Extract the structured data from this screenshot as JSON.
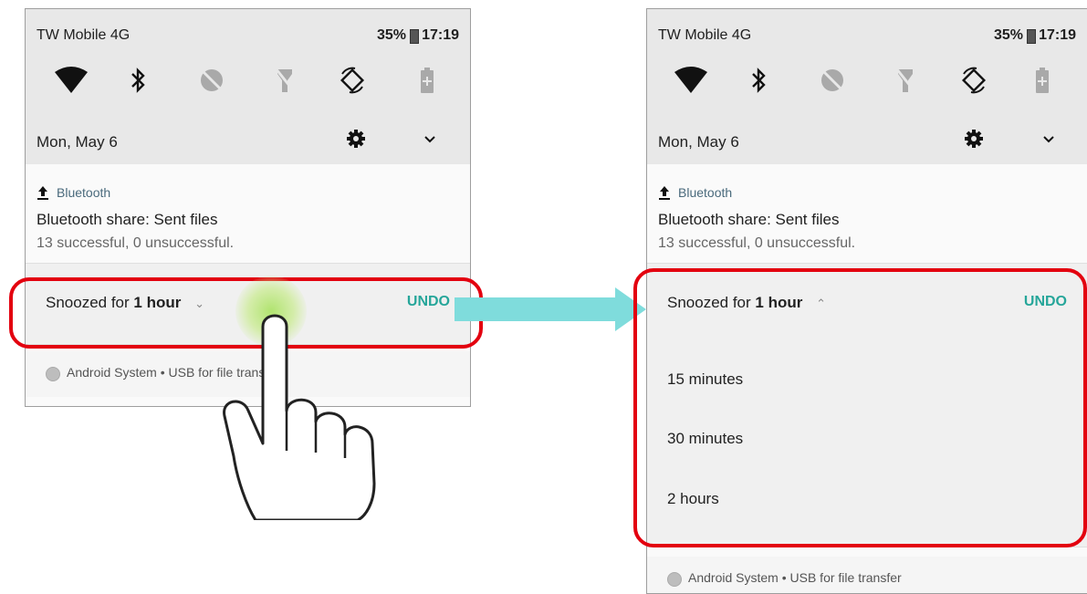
{
  "left_screen": {
    "status": {
      "carrier": "TW Mobile 4G",
      "battery": "35%",
      "time": "17:19"
    },
    "date": "Mon, May 6",
    "notification": {
      "app": "Bluetooth",
      "title": "Bluetooth share: Sent files",
      "text": "13 successful, 0 unsuccessful."
    },
    "snooze": {
      "prefix": "Snoozed for",
      "duration": "1 hour",
      "undo": "UNDO"
    },
    "system_row": "Android System • USB for file transfer"
  },
  "right_screen": {
    "status": {
      "carrier": "TW Mobile 4G",
      "battery": "35%",
      "time": "17:19"
    },
    "date": "Mon, May 6",
    "notification": {
      "app": "Bluetooth",
      "title": "Bluetooth share: Sent files",
      "text": "13 successful, 0 unsuccessful."
    },
    "snooze": {
      "prefix": "Snoozed for",
      "duration": "1 hour",
      "undo": "UNDO"
    },
    "options": [
      "15 minutes",
      "30 minutes",
      "2 hours"
    ],
    "system_row": "Android System • USB for file transfer"
  },
  "colors": {
    "accent": "#26a69a",
    "highlight": "#e3000f",
    "arrow": "#7fdcdc",
    "qs_bg": "#e8e8e8",
    "touch": "#ade368"
  },
  "icons": [
    "wifi-icon",
    "bluetooth-icon",
    "dnd-icon",
    "flashlight-off-icon",
    "auto-rotate-icon",
    "battery-saver-icon",
    "settings-gear-icon",
    "expand-chevron-icon",
    "upload-icon",
    "hand-pointer-icon"
  ]
}
